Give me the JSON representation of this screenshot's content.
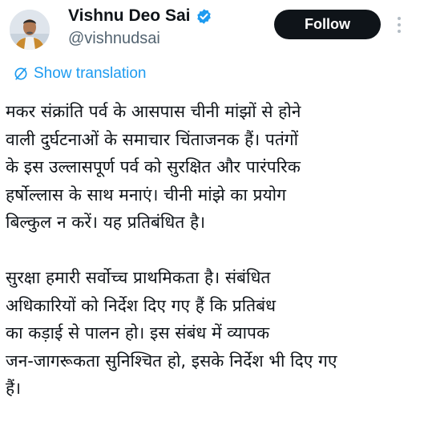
{
  "author": {
    "name": "Vishnu Deo Sai",
    "handle": "@vishnudsai",
    "verified": true,
    "avatar_icon": "profile-photo-icon"
  },
  "actions": {
    "follow_label": "Follow",
    "more_icon": "more-options-icon"
  },
  "translation": {
    "label": "Show translation",
    "icon": "translate-icon"
  },
  "tweet": {
    "paragraphs": [
      {
        "lines": [
          "मकर संक्रांति पर्व के आसपास चीनी मांझों से होने",
          "वाली दुर्घटनाओं के समाचार चिंताजनक हैं। पतंगों",
          "के इस उल्लासपूर्ण पर्व को सुरक्षित और पारंपरिक",
          "हर्षोल्लास के साथ मनाएं। चीनी मांझे का प्रयोग",
          "बिल्कुल न करें। यह प्रतिबंधित है।"
        ]
      },
      {
        "lines": [
          "सुरक्षा हमारी सर्वोच्च प्राथमिकता है। संबंधित",
          "अधिकारियों को निर्देश दिए गए हैं कि प्रतिबंध",
          "का कड़ाई से पालन हो। इस संबंध में व्यापक",
          "जन-जागरूकता सुनिश्चित हो, इसके निर्देश भी दिए गए",
          "हैं।"
        ]
      }
    ]
  },
  "colors": {
    "text": "#0f1419",
    "secondary": "#536471",
    "accent": "#1d9bf0",
    "follow_bg": "#0f1419",
    "follow_text": "#ffffff"
  }
}
